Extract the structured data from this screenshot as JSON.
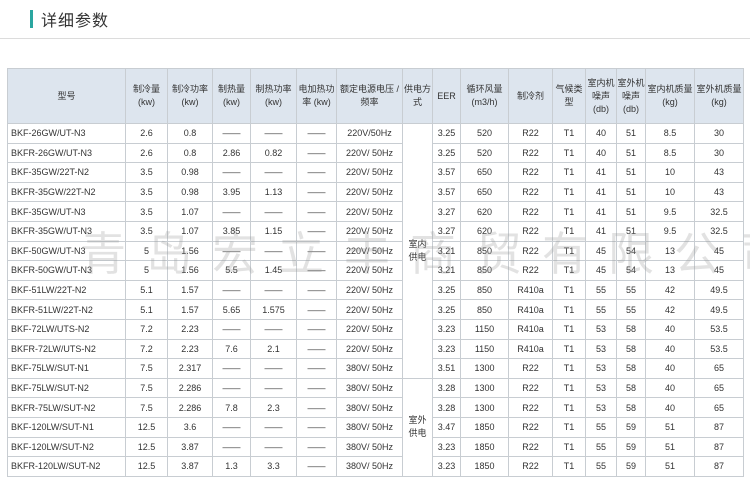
{
  "heading": "详细参数",
  "columns": [
    {
      "key": "model",
      "label": "型号"
    },
    {
      "key": "cool",
      "label": "制冷量 (kw)"
    },
    {
      "key": "coolpw",
      "label": "制冷功率 (kw)"
    },
    {
      "key": "heat",
      "label": "制热量 (kw)"
    },
    {
      "key": "heatpw",
      "label": "制热功率 (kw)"
    },
    {
      "key": "eheat",
      "label": "电加热功率 (kw)"
    },
    {
      "key": "voltage",
      "label": "额定电源电压 / 频率"
    },
    {
      "key": "supply",
      "label": "供电方式"
    },
    {
      "key": "eer",
      "label": "EER"
    },
    {
      "key": "air",
      "label": "循环风量 (m3/h)"
    },
    {
      "key": "refr",
      "label": "制冷剂"
    },
    {
      "key": "climate",
      "label": "气候类型"
    },
    {
      "key": "innoise",
      "label": "室内机噪声 (db)"
    },
    {
      "key": "outnoise",
      "label": "室外机噪声 (db)"
    },
    {
      "key": "inmass",
      "label": "室内机质量 (kg)"
    },
    {
      "key": "outmass",
      "label": "室外机质量 (kg)"
    }
  ],
  "supply_groups": [
    {
      "label": "室内供电",
      "rows": 13
    },
    {
      "label": "室外供电",
      "rows": 6
    }
  ],
  "rows": [
    [
      "BKF-26GW/UT-N3",
      "2.6",
      "0.8",
      "——",
      "——",
      "——",
      "220V/50Hz",
      "3.25",
      "520",
      "R22",
      "T1",
      "40",
      "51",
      "8.5",
      "30"
    ],
    [
      "BKFR-26GW/UT-N3",
      "2.6",
      "0.8",
      "2.86",
      "0.82",
      "——",
      "220V/ 50Hz",
      "3.25",
      "520",
      "R22",
      "T1",
      "40",
      "51",
      "8.5",
      "30"
    ],
    [
      "BKF-35GW/22T-N2",
      "3.5",
      "0.98",
      "——",
      "——",
      "——",
      "220V/ 50Hz",
      "3.57",
      "650",
      "R22",
      "T1",
      "41",
      "51",
      "10",
      "43"
    ],
    [
      "BKFR-35GW/22T-N2",
      "3.5",
      "0.98",
      "3.95",
      "1.13",
      "——",
      "220V/ 50Hz",
      "3.57",
      "650",
      "R22",
      "T1",
      "41",
      "51",
      "10",
      "43"
    ],
    [
      "BKF-35GW/UT-N3",
      "3.5",
      "1.07",
      "——",
      "——",
      "——",
      "220V/ 50Hz",
      "3.27",
      "620",
      "R22",
      "T1",
      "41",
      "51",
      "9.5",
      "32.5"
    ],
    [
      "BKFR-35GW/UT-N3",
      "3.5",
      "1.07",
      "3.85",
      "1.15",
      "——",
      "220V/ 50Hz",
      "3.27",
      "620",
      "R22",
      "T1",
      "41",
      "51",
      "9.5",
      "32.5"
    ],
    [
      "BKF-50GW/UT-N3",
      "5",
      "1.56",
      "——",
      "——",
      "——",
      "220V/ 50Hz",
      "3.21",
      "850",
      "R22",
      "T1",
      "45",
      "54",
      "13",
      "45"
    ],
    [
      "BKFR-50GW/UT-N3",
      "5",
      "1.56",
      "5.5",
      "1.45",
      "——",
      "220V/ 50Hz",
      "3.21",
      "850",
      "R22",
      "T1",
      "45",
      "54",
      "13",
      "45"
    ],
    [
      "BKF-51LW/22T-N2",
      "5.1",
      "1.57",
      "——",
      "——",
      "——",
      "220V/ 50Hz",
      "3.25",
      "850",
      "R410a",
      "T1",
      "55",
      "55",
      "42",
      "49.5"
    ],
    [
      "BKFR-51LW/22T-N2",
      "5.1",
      "1.57",
      "5.65",
      "1.575",
      "——",
      "220V/ 50Hz",
      "3.25",
      "850",
      "R410a",
      "T1",
      "55",
      "55",
      "42",
      "49.5"
    ],
    [
      "BKF-72LW/UTS-N2",
      "7.2",
      "2.23",
      "——",
      "——",
      "——",
      "220V/ 50Hz",
      "3.23",
      "1150",
      "R410a",
      "T1",
      "53",
      "58",
      "40",
      "53.5"
    ],
    [
      "BKFR-72LW/UTS-N2",
      "7.2",
      "2.23",
      "7.6",
      "2.1",
      "——",
      "220V/ 50Hz",
      "3.23",
      "1150",
      "R410a",
      "T1",
      "53",
      "58",
      "40",
      "53.5"
    ],
    [
      "BKF-75LW/SUT-N1",
      "7.5",
      "2.317",
      "——",
      "——",
      "——",
      "380V/ 50Hz",
      "3.51",
      "1300",
      "R22",
      "T1",
      "53",
      "58",
      "40",
      "65"
    ],
    [
      "BKF-75LW/SUT-N2",
      "7.5",
      "2.286",
      "——",
      "——",
      "——",
      "380V/ 50Hz",
      "3.28",
      "1300",
      "R22",
      "T1",
      "53",
      "58",
      "40",
      "65"
    ],
    [
      "BKFR-75LW/SUT-N2",
      "7.5",
      "2.286",
      "7.8",
      "2.3",
      "——",
      "380V/ 50Hz",
      "3.28",
      "1300",
      "R22",
      "T1",
      "53",
      "58",
      "40",
      "65"
    ],
    [
      "BKF-120LW/SUT-N1",
      "12.5",
      "3.6",
      "——",
      "——",
      "——",
      "380V/ 50Hz",
      "3.47",
      "1850",
      "R22",
      "T1",
      "55",
      "59",
      "51",
      "87"
    ],
    [
      "BKF-120LW/SUT-N2",
      "12.5",
      "3.87",
      "——",
      "——",
      "——",
      "380V/ 50Hz",
      "3.23",
      "1850",
      "R22",
      "T1",
      "55",
      "59",
      "51",
      "87"
    ],
    [
      "BKFR-120LW/SUT-N2",
      "12.5",
      "3.87",
      "1.3",
      "3.3",
      "——",
      "380V/ 50Hz",
      "3.23",
      "1850",
      "R22",
      "T1",
      "55",
      "59",
      "51",
      "87"
    ]
  ],
  "watermark": "青岛宏立丰商贸有限公司"
}
